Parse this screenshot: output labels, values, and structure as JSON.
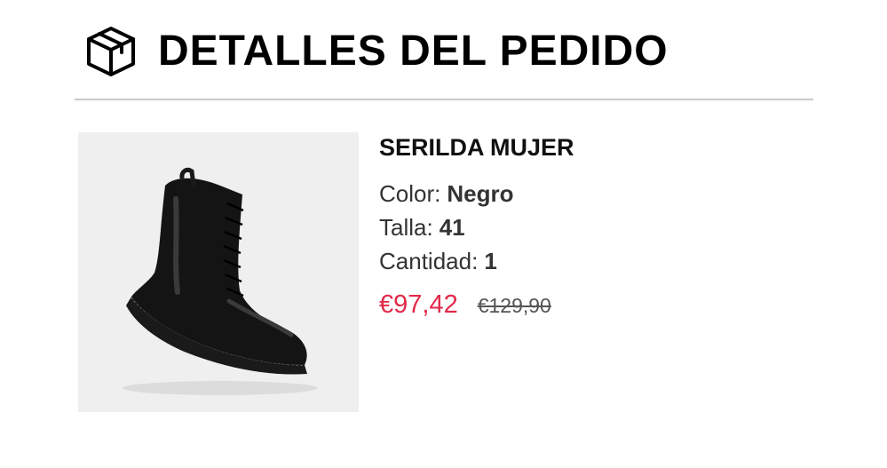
{
  "header": {
    "icon": "package-box-icon",
    "title": "DETALLES DEL PEDIDO"
  },
  "product": {
    "image_icon": "black-leather-ankle-boot",
    "name": "SERILDA MUJER",
    "attributes": [
      {
        "label": "Color:",
        "value": "Negro"
      },
      {
        "label": "Talla:",
        "value": "41"
      },
      {
        "label": "Cantidad:",
        "value": "1"
      }
    ],
    "price_current": "€97,42",
    "price_original": "€129,90"
  },
  "colors": {
    "price_current": "#e2294a",
    "image_background": "#efefef",
    "divider": "#c9c9c9"
  }
}
